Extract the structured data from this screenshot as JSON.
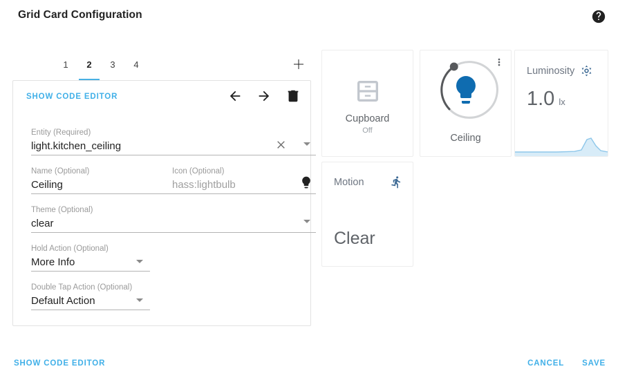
{
  "dialog": {
    "title": "Grid Card Configuration",
    "help_icon": "help-circle-icon"
  },
  "tabs": {
    "items": [
      {
        "label": "1",
        "selected": false
      },
      {
        "label": "2",
        "selected": true
      },
      {
        "label": "3",
        "selected": false
      },
      {
        "label": "4",
        "selected": false
      }
    ],
    "add_icon": "plus-icon"
  },
  "editor": {
    "show_code_editor_label": "SHOW CODE EDITOR",
    "nav": {
      "move_back_icon": "arrow-left-icon",
      "move_forward_icon": "arrow-right-icon",
      "delete_icon": "trash-icon"
    },
    "fields": {
      "entity": {
        "label": "Entity (Required)",
        "value": "light.kitchen_ceiling",
        "clear_icon": "close-icon",
        "dropdown_icon": "caret-down-icon"
      },
      "name": {
        "label": "Name (Optional)",
        "value": "Ceiling"
      },
      "icon": {
        "label": "Icon (Optional)",
        "value": "hass:lightbulb",
        "is_placeholder": true,
        "preview_icon": "lightbulb-icon"
      },
      "theme": {
        "label": "Theme (Optional)",
        "value": "clear",
        "dropdown_icon": "caret-down-icon"
      },
      "hold_action": {
        "label": "Hold Action (Optional)",
        "value": "More Info",
        "dropdown_icon": "caret-down-icon"
      },
      "double_tap_action": {
        "label": "Double Tap Action (Optional)",
        "value": "Default Action",
        "dropdown_icon": "caret-down-icon"
      }
    }
  },
  "preview": {
    "cupboard": {
      "name": "Cupboard",
      "state": "Off",
      "icon": "cupboard-icon"
    },
    "ceiling": {
      "name": "Ceiling",
      "more_icon": "dots-vertical-icon",
      "bulb_icon": "lightbulb-icon",
      "accent_color": "#0f6cb0",
      "dial_active_color": "#57595c",
      "dial_track_color": "#d2d4d6"
    },
    "luminosity": {
      "title": "Luminosity",
      "icon": "brightness-icon",
      "value": "1.0",
      "unit": "lx",
      "graph_color": "#8ec7ea"
    },
    "motion": {
      "title": "Motion",
      "icon": "walk-icon",
      "state": "Clear"
    }
  },
  "footer": {
    "show_code_editor_label": "SHOW CODE EDITOR",
    "cancel_label": "CANCEL",
    "save_label": "SAVE"
  },
  "colors": {
    "accent": "#41b0e8",
    "tab_indicator": "#49b1e4",
    "light_on": "#0f6cb0"
  }
}
